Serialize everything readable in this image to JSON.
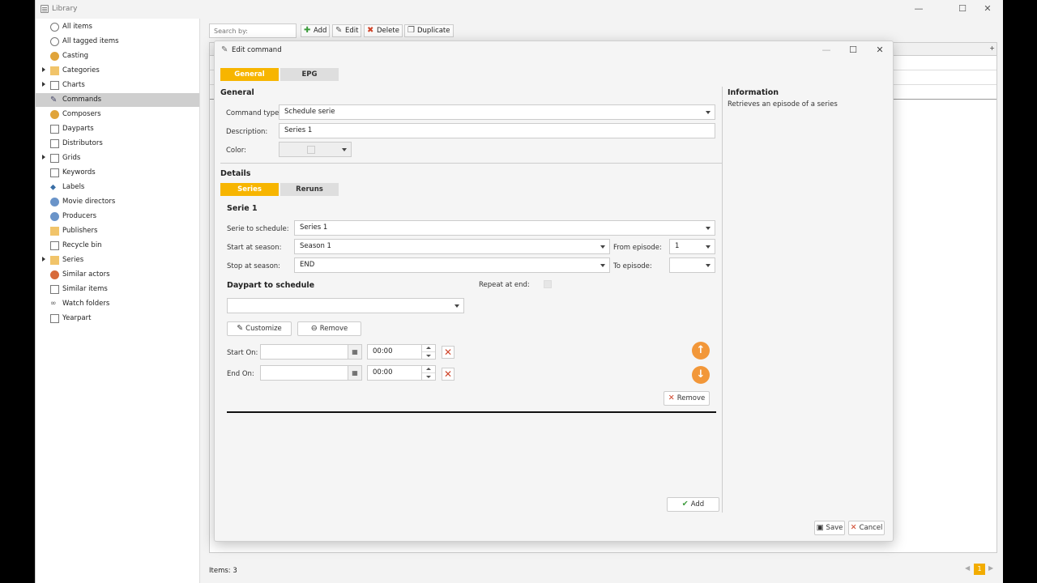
{
  "window": {
    "title": "Library"
  },
  "sidebar": {
    "items": [
      {
        "label": "All items"
      },
      {
        "label": "All tagged items"
      },
      {
        "label": "Casting"
      },
      {
        "label": "Categories"
      },
      {
        "label": "Charts"
      },
      {
        "label": "Commands"
      },
      {
        "label": "Composers"
      },
      {
        "label": "Dayparts"
      },
      {
        "label": "Distributors"
      },
      {
        "label": "Grids"
      },
      {
        "label": "Keywords"
      },
      {
        "label": "Labels"
      },
      {
        "label": "Movie directors"
      },
      {
        "label": "Producers"
      },
      {
        "label": "Publishers"
      },
      {
        "label": "Recycle bin"
      },
      {
        "label": "Series"
      },
      {
        "label": "Similar actors"
      },
      {
        "label": "Similar items"
      },
      {
        "label": "Watch folders"
      },
      {
        "label": "Yearpart"
      }
    ]
  },
  "toolbar": {
    "search_placeholder": "Search by:",
    "add": "Add",
    "edit": "Edit",
    "delete": "Delete",
    "duplicate": "Duplicate"
  },
  "status": {
    "items": "Items: 3",
    "page": "1"
  },
  "dialog": {
    "title": "Edit command",
    "tabs": [
      "General",
      "EPG"
    ],
    "general_heading": "General",
    "command_type_label": "Command type:",
    "command_type_value": "Schedule serie",
    "description_label": "Description:",
    "description_value": "Series 1",
    "color_label": "Color:",
    "details_heading": "Details",
    "detail_tabs": [
      "Series",
      "Reruns"
    ],
    "serie_heading": "Serie 1",
    "serie_to_schedule_label": "Serie to schedule:",
    "serie_to_schedule_value": "Series 1",
    "start_season_label": "Start at season:",
    "start_season_value": "Season 1",
    "stop_season_label": "Stop at season:",
    "stop_season_value": "END",
    "from_episode_label": "From episode:",
    "from_episode_value": "1",
    "to_episode_label": "To episode:",
    "to_episode_value": "",
    "daypart_heading": "Daypart to schedule",
    "repeat_label": "Repeat at end:",
    "customize": "Customize",
    "remove": "Remove",
    "start_on_label": "Start On:",
    "end_on_label": "End On:",
    "start_time": "00:00",
    "end_time": "00:00",
    "remove2": "Remove",
    "add": "Add",
    "info_heading": "Information",
    "info_text": "Retrieves an episode of a series",
    "save": "Save",
    "cancel": "Cancel"
  },
  "colors": {
    "accent": "#f7b500",
    "orange_button": "#f29739",
    "red_x": "#d0452a"
  }
}
